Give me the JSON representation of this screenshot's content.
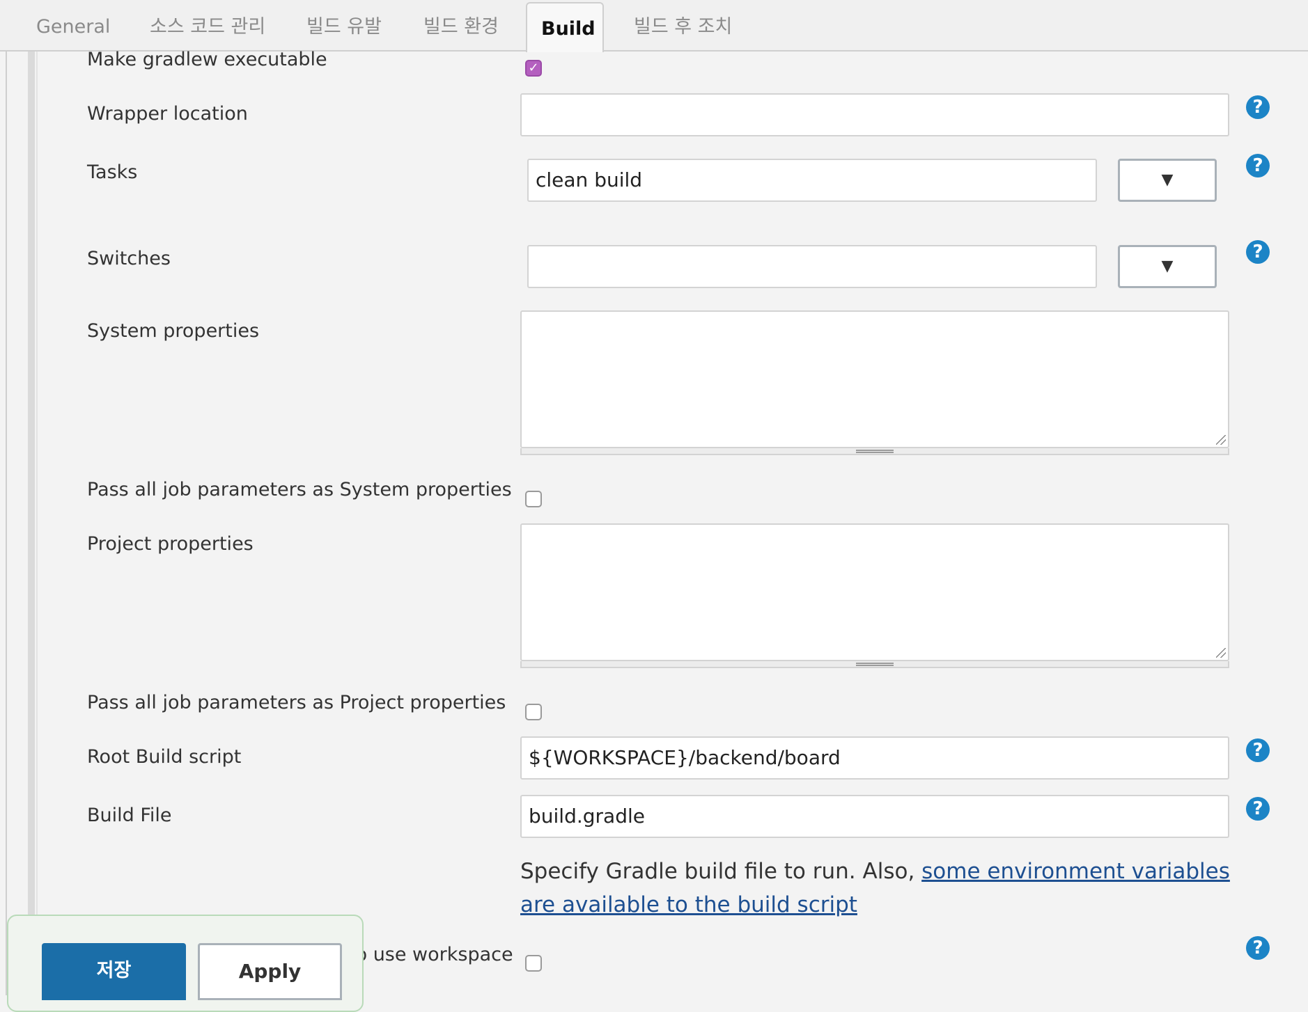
{
  "tabs": [
    {
      "label": "General",
      "active": false
    },
    {
      "label": "소스 코드 관리",
      "active": false
    },
    {
      "label": "빌드 유발",
      "active": false
    },
    {
      "label": "빌드 환경",
      "active": false
    },
    {
      "label": "Build",
      "active": true
    },
    {
      "label": "빌드 후 조치",
      "active": false
    }
  ],
  "fields": {
    "make_executable": {
      "label": "Make gradlew executable",
      "checked": true
    },
    "wrapper_location": {
      "label": "Wrapper location",
      "value": ""
    },
    "tasks": {
      "label": "Tasks",
      "value": "clean build"
    },
    "switches": {
      "label": "Switches",
      "value": ""
    },
    "system_properties": {
      "label": "System properties",
      "value": ""
    },
    "pass_system": {
      "label": "Pass all job parameters as System properties",
      "checked": false
    },
    "project_properties": {
      "label": "Project properties",
      "value": ""
    },
    "pass_project": {
      "label": "Pass all job parameters as Project properties",
      "checked": false
    },
    "root_build_script": {
      "label": "Root Build script",
      "value": "${WORKSPACE}/backend/board"
    },
    "build_file": {
      "label": "Build File",
      "value": "build.gradle",
      "description": "Specify Gradle build file to run. Also, ",
      "link": "some environment variables are available to the build script"
    },
    "use_workspace": {
      "label": "to use workspace",
      "checked": false
    }
  },
  "dropdown_glyph": "▼",
  "help_glyph": "?",
  "check_glyph": "✓",
  "buttons": {
    "save": "저장",
    "apply": "Apply"
  },
  "colors": {
    "primary": "#1b6ea8",
    "help": "#1c84c6",
    "checkbox_checked": "#b45fbf",
    "link": "#1d4f91"
  }
}
